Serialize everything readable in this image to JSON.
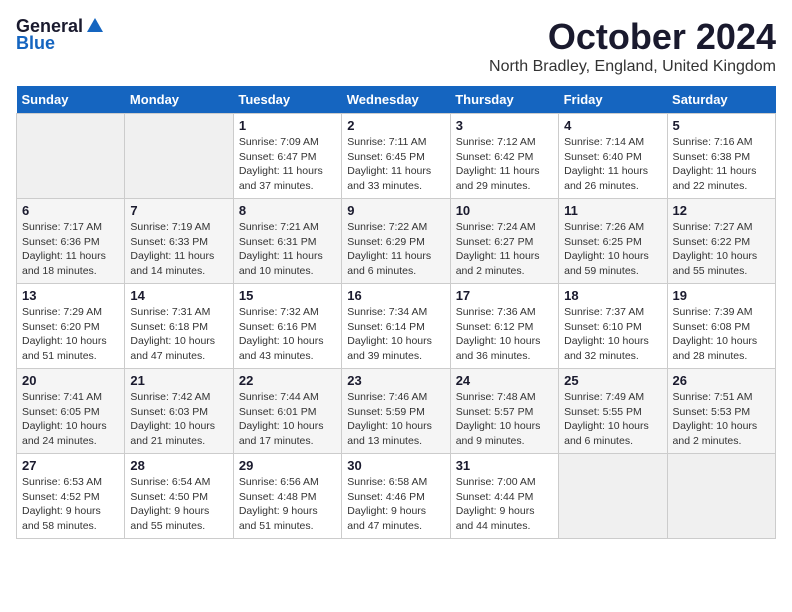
{
  "logo": {
    "general": "General",
    "blue": "Blue"
  },
  "title": "October 2024",
  "subtitle": "North Bradley, England, United Kingdom",
  "days_of_week": [
    "Sunday",
    "Monday",
    "Tuesday",
    "Wednesday",
    "Thursday",
    "Friday",
    "Saturday"
  ],
  "weeks": [
    [
      {
        "day": "",
        "info": ""
      },
      {
        "day": "",
        "info": ""
      },
      {
        "day": "1",
        "info": "Sunrise: 7:09 AM\nSunset: 6:47 PM\nDaylight: 11 hours and 37 minutes."
      },
      {
        "day": "2",
        "info": "Sunrise: 7:11 AM\nSunset: 6:45 PM\nDaylight: 11 hours and 33 minutes."
      },
      {
        "day": "3",
        "info": "Sunrise: 7:12 AM\nSunset: 6:42 PM\nDaylight: 11 hours and 29 minutes."
      },
      {
        "day": "4",
        "info": "Sunrise: 7:14 AM\nSunset: 6:40 PM\nDaylight: 11 hours and 26 minutes."
      },
      {
        "day": "5",
        "info": "Sunrise: 7:16 AM\nSunset: 6:38 PM\nDaylight: 11 hours and 22 minutes."
      }
    ],
    [
      {
        "day": "6",
        "info": "Sunrise: 7:17 AM\nSunset: 6:36 PM\nDaylight: 11 hours and 18 minutes."
      },
      {
        "day": "7",
        "info": "Sunrise: 7:19 AM\nSunset: 6:33 PM\nDaylight: 11 hours and 14 minutes."
      },
      {
        "day": "8",
        "info": "Sunrise: 7:21 AM\nSunset: 6:31 PM\nDaylight: 11 hours and 10 minutes."
      },
      {
        "day": "9",
        "info": "Sunrise: 7:22 AM\nSunset: 6:29 PM\nDaylight: 11 hours and 6 minutes."
      },
      {
        "day": "10",
        "info": "Sunrise: 7:24 AM\nSunset: 6:27 PM\nDaylight: 11 hours and 2 minutes."
      },
      {
        "day": "11",
        "info": "Sunrise: 7:26 AM\nSunset: 6:25 PM\nDaylight: 10 hours and 59 minutes."
      },
      {
        "day": "12",
        "info": "Sunrise: 7:27 AM\nSunset: 6:22 PM\nDaylight: 10 hours and 55 minutes."
      }
    ],
    [
      {
        "day": "13",
        "info": "Sunrise: 7:29 AM\nSunset: 6:20 PM\nDaylight: 10 hours and 51 minutes."
      },
      {
        "day": "14",
        "info": "Sunrise: 7:31 AM\nSunset: 6:18 PM\nDaylight: 10 hours and 47 minutes."
      },
      {
        "day": "15",
        "info": "Sunrise: 7:32 AM\nSunset: 6:16 PM\nDaylight: 10 hours and 43 minutes."
      },
      {
        "day": "16",
        "info": "Sunrise: 7:34 AM\nSunset: 6:14 PM\nDaylight: 10 hours and 39 minutes."
      },
      {
        "day": "17",
        "info": "Sunrise: 7:36 AM\nSunset: 6:12 PM\nDaylight: 10 hours and 36 minutes."
      },
      {
        "day": "18",
        "info": "Sunrise: 7:37 AM\nSunset: 6:10 PM\nDaylight: 10 hours and 32 minutes."
      },
      {
        "day": "19",
        "info": "Sunrise: 7:39 AM\nSunset: 6:08 PM\nDaylight: 10 hours and 28 minutes."
      }
    ],
    [
      {
        "day": "20",
        "info": "Sunrise: 7:41 AM\nSunset: 6:05 PM\nDaylight: 10 hours and 24 minutes."
      },
      {
        "day": "21",
        "info": "Sunrise: 7:42 AM\nSunset: 6:03 PM\nDaylight: 10 hours and 21 minutes."
      },
      {
        "day": "22",
        "info": "Sunrise: 7:44 AM\nSunset: 6:01 PM\nDaylight: 10 hours and 17 minutes."
      },
      {
        "day": "23",
        "info": "Sunrise: 7:46 AM\nSunset: 5:59 PM\nDaylight: 10 hours and 13 minutes."
      },
      {
        "day": "24",
        "info": "Sunrise: 7:48 AM\nSunset: 5:57 PM\nDaylight: 10 hours and 9 minutes."
      },
      {
        "day": "25",
        "info": "Sunrise: 7:49 AM\nSunset: 5:55 PM\nDaylight: 10 hours and 6 minutes."
      },
      {
        "day": "26",
        "info": "Sunrise: 7:51 AM\nSunset: 5:53 PM\nDaylight: 10 hours and 2 minutes."
      }
    ],
    [
      {
        "day": "27",
        "info": "Sunrise: 6:53 AM\nSunset: 4:52 PM\nDaylight: 9 hours and 58 minutes."
      },
      {
        "day": "28",
        "info": "Sunrise: 6:54 AM\nSunset: 4:50 PM\nDaylight: 9 hours and 55 minutes."
      },
      {
        "day": "29",
        "info": "Sunrise: 6:56 AM\nSunset: 4:48 PM\nDaylight: 9 hours and 51 minutes."
      },
      {
        "day": "30",
        "info": "Sunrise: 6:58 AM\nSunset: 4:46 PM\nDaylight: 9 hours and 47 minutes."
      },
      {
        "day": "31",
        "info": "Sunrise: 7:00 AM\nSunset: 4:44 PM\nDaylight: 9 hours and 44 minutes."
      },
      {
        "day": "",
        "info": ""
      },
      {
        "day": "",
        "info": ""
      }
    ]
  ]
}
